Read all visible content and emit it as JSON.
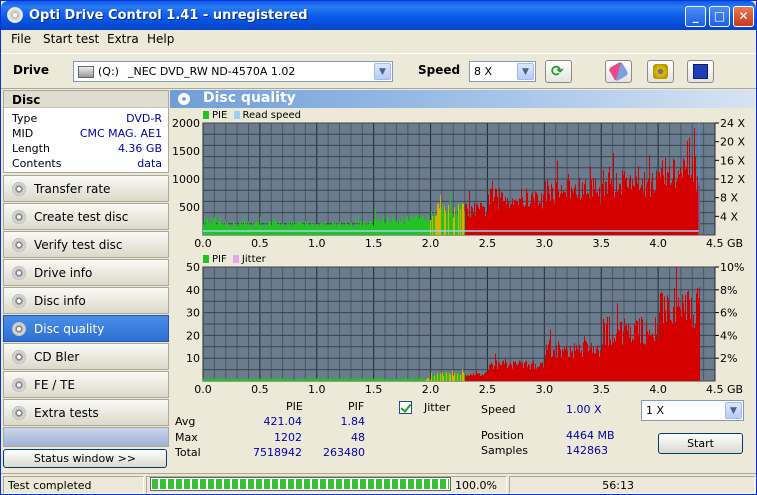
{
  "window": {
    "title": "Opti Drive Control 1.41 - unregistered"
  },
  "menu": [
    "File",
    "Start test",
    "Extra",
    "Help"
  ],
  "toolbar": {
    "drive_label": "Drive",
    "drive_letter": "(Q:)",
    "drive_value": "_NEC DVD_RW ND-4570A 1.02",
    "speed_label": "Speed",
    "speed_value": "8 X"
  },
  "disc": {
    "header": "Disc",
    "rows": [
      {
        "key": "Type",
        "value": "DVD-R"
      },
      {
        "key": "MID",
        "value": "CMC MAG. AE1"
      },
      {
        "key": "Length",
        "value": "4.36 GB"
      },
      {
        "key": "Contents",
        "value": "data"
      }
    ]
  },
  "nav": [
    {
      "label": "Transfer rate",
      "active": false
    },
    {
      "label": "Create test disc",
      "active": false
    },
    {
      "label": "Verify test disc",
      "active": false
    },
    {
      "label": "Drive info",
      "active": false
    },
    {
      "label": "Disc info",
      "active": false
    },
    {
      "label": "Disc quality",
      "active": true
    },
    {
      "label": "CD Bler",
      "active": false
    },
    {
      "label": "FE / TE",
      "active": false
    },
    {
      "label": "Extra tests",
      "active": false
    }
  ],
  "status_window_label": "Status window >>",
  "panel": {
    "title": "Disc quality"
  },
  "chart_data": [
    {
      "type": "bar",
      "legend": [
        "PIE",
        "Read speed"
      ],
      "colors": {
        "pie_low": "#22c322",
        "pie_mid": "#d9b000",
        "pie_high": "#d40000",
        "read_speed": "#9ad0f5",
        "plot_bg": "#6a7c8e",
        "grid": "#2a2f3a"
      },
      "x_ticks": [
        "0.0",
        "0.5",
        "1.0",
        "1.5",
        "2.0",
        "2.5",
        "3.0",
        "3.5",
        "4.0",
        "4.5 GB"
      ],
      "xlim": [
        0,
        4.5
      ],
      "y_left_ticks": [
        "2000",
        "1500",
        "1000",
        "500"
      ],
      "ylim": [
        0,
        2000
      ],
      "y_right_ticks": [
        "24 X",
        "20 X",
        "16 X",
        "12 X",
        "8 X",
        "4 X"
      ],
      "segments": [
        {
          "x": [
            0.0,
            0.1
          ],
          "level": 250
        },
        {
          "x": [
            0.1,
            1.5
          ],
          "level": 200
        },
        {
          "x": [
            1.5,
            2.0
          ],
          "level": 280
        },
        {
          "x": [
            2.0,
            2.5
          ],
          "level": 450
        },
        {
          "x": [
            2.5,
            3.0
          ],
          "level": 650
        },
        {
          "x": [
            3.0,
            3.5
          ],
          "level": 800
        },
        {
          "x": [
            3.5,
            4.0
          ],
          "level": 950
        },
        {
          "x": [
            4.0,
            4.36
          ],
          "level": 1080
        }
      ]
    },
    {
      "type": "bar",
      "legend": [
        "PIF",
        "Jitter"
      ],
      "colors": {
        "jitter": "#e8a6e8"
      },
      "x_ticks": [
        "0.0",
        "0.5",
        "1.0",
        "1.5",
        "2.0",
        "2.5",
        "3.0",
        "3.5",
        "4.0",
        "4.5 GB"
      ],
      "xlim": [
        0,
        4.5
      ],
      "y_left_ticks": [
        "50",
        "40",
        "30",
        "20",
        "10"
      ],
      "ylim": [
        0,
        50
      ],
      "y_right_ticks": [
        "10%",
        "8%",
        "6%",
        "4%",
        "2%"
      ],
      "segments": [
        {
          "x": [
            0.0,
            2.0
          ],
          "level": 1
        },
        {
          "x": [
            2.0,
            2.5
          ],
          "level": 3
        },
        {
          "x": [
            2.5,
            3.0
          ],
          "level": 7
        },
        {
          "x": [
            3.0,
            3.5
          ],
          "level": 14
        },
        {
          "x": [
            3.5,
            4.0
          ],
          "level": 22
        },
        {
          "x": [
            4.0,
            4.36
          ],
          "level": 32
        }
      ]
    }
  ],
  "stats": {
    "col_pie": "PIE",
    "col_pif": "PIF",
    "rows": [
      {
        "label": "Avg",
        "pie": "421.04",
        "pif": "1.84"
      },
      {
        "label": "Max",
        "pie": "1202",
        "pif": "48"
      },
      {
        "label": "Total",
        "pie": "7518942",
        "pif": "263480"
      }
    ],
    "jitter_label": "Jitter",
    "speed_label": "Speed",
    "speed_value": "1.00 X",
    "speed_select": "1 X",
    "position_label": "Position",
    "position_value": "4464 MB",
    "samples_label": "Samples",
    "samples_value": "142863",
    "start_label": "Start"
  },
  "statusbar": {
    "text": "Test completed",
    "progress": "100.0%",
    "progress_fraction": 1.0,
    "time": "56:13"
  }
}
